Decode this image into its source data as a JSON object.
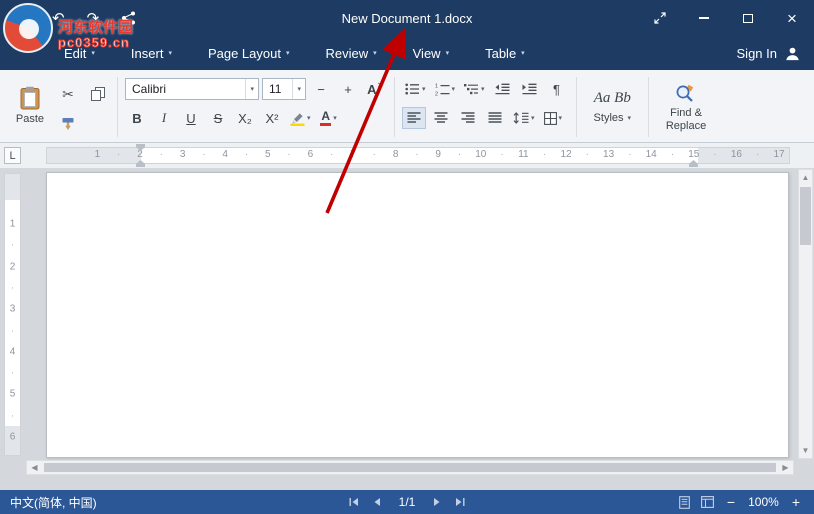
{
  "window": {
    "title": "New Document 1.docx"
  },
  "watermark": {
    "site_name": "河东软件园",
    "site_url": "pc0359.cn"
  },
  "menu": {
    "tabs": [
      "Edit",
      "Insert",
      "Page Layout",
      "Review",
      "View",
      "Table"
    ],
    "sign_in_label": "Sign In"
  },
  "toolbar": {
    "paste_label": "Paste",
    "font_name": "Calibri",
    "font_size": "11",
    "decrease_font": "−",
    "increase_font": "+",
    "clear_format_letter": "A",
    "bold": "B",
    "italic": "I",
    "underline": "U",
    "strikethrough": "S",
    "subscript": "X₂",
    "superscript": "X²",
    "font_color_letter": "A",
    "pilcrow": "¶",
    "styles_preview": "Aa Bb",
    "styles_label": "Styles",
    "find_replace_label": "Find & Replace"
  },
  "ruler": {
    "corner_label": "L",
    "h_numbers": [
      "1",
      "2",
      "3",
      "4",
      "5",
      "6",
      "7",
      "8",
      "9",
      "10",
      "11",
      "12",
      "13",
      "14",
      "15",
      "16",
      "17"
    ],
    "v_numbers": [
      "1",
      "2",
      "3",
      "4",
      "5",
      "6"
    ]
  },
  "scrollbar": {
    "up": "▲",
    "down": "▼",
    "left": "◀",
    "right": "▶"
  },
  "status": {
    "language": "中文(简体, 中国)",
    "page_indicator": "1/1",
    "zoom_out": "−",
    "zoom_level": "100%",
    "zoom_in": "+"
  },
  "icons": {
    "undo": "↶",
    "redo": "↷",
    "cut": "✂",
    "caret": "▾",
    "close": "×",
    "clear_x": "×",
    "save": "floppy-disk",
    "share": "share-nodes",
    "paste": "clipboard",
    "copy": "two-pages",
    "format_painter": "brush",
    "highlight": "highlighter-pen",
    "find_replace": "magnifier-with-pencil",
    "sign_in": "person-silhouette"
  },
  "colors": {
    "titlebar_bg": "#1d3b63",
    "statusbar_bg": "#2b5797",
    "ribbon_bg": "#f2f4f7",
    "annotation_red": "#c00000",
    "highlight_yellow": "#ffd800",
    "font_color_red": "#d93025"
  }
}
